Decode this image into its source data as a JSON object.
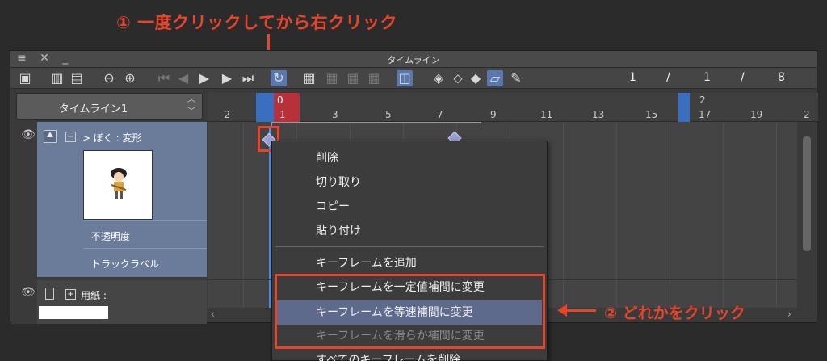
{
  "annotations": {
    "top": "① 一度クリックしてから右クリック",
    "right": "② どれかをクリック"
  },
  "window": {
    "title": "タイムライン",
    "controls": "≡ ✕ _"
  },
  "toolbar": {
    "frame_current": "1",
    "sep1": "/",
    "frame_mid": "1",
    "sep2": "/",
    "frame_total": "8"
  },
  "timeline_name": "タイムライン1",
  "layers": {
    "main_label": "> ぼく : 変形",
    "sub_opacity": "不透明度",
    "sub_track": "トラックラベル",
    "paper_label": "用紙 :"
  },
  "ruler": {
    "current_frame": "0",
    "second_mark": "2",
    "ticks": [
      "-2",
      "1",
      "3",
      "5",
      "7",
      "9",
      "11",
      "13",
      "15",
      "17",
      "19",
      "2"
    ]
  },
  "context_menu": {
    "items": [
      {
        "label": "削除"
      },
      {
        "label": "切り取り"
      },
      {
        "label": "コピー"
      },
      {
        "label": "貼り付け"
      },
      {
        "label": "キーフレームを追加"
      },
      {
        "label": "キーフレームを一定値補間に変更"
      },
      {
        "label": "キーフレームを等速補間に変更"
      },
      {
        "label": "キーフレームを滑らか補間に変更"
      },
      {
        "label": "すべてのキーフレームを削除"
      }
    ]
  },
  "colors": {
    "annotation": "#e8442a",
    "highlight": "#5e6a8c",
    "layer_selected": "#6b7b9a",
    "playhead": "#3a6fbf",
    "current_frame": "#b8303a"
  }
}
